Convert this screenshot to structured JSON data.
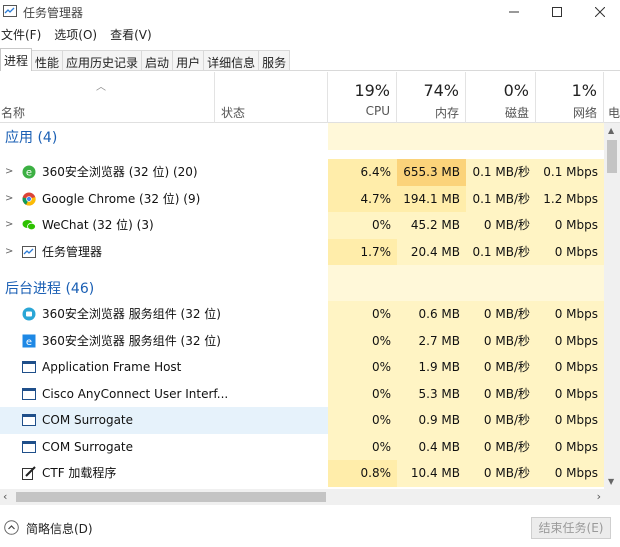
{
  "window": {
    "title": "任务管理器"
  },
  "menu": [
    "文件(F)",
    "选项(O)",
    "查看(V)"
  ],
  "tabs": [
    "进程",
    "性能",
    "应用历史记录",
    "启动",
    "用户",
    "详细信息",
    "服务"
  ],
  "header": {
    "name_label": "名称",
    "status_label": "状态",
    "cpu": {
      "pct": "19%",
      "label": "CPU"
    },
    "mem": {
      "pct": "74%",
      "label": "内存"
    },
    "disk": {
      "pct": "0%",
      "label": "磁盘"
    },
    "net": {
      "pct": "1%",
      "label": "网络"
    },
    "extra": "电"
  },
  "groups": {
    "apps": "应用 (4)",
    "background": "后台进程 (46)"
  },
  "apps": [
    {
      "name": "360安全浏览器 (32 位) (20)",
      "icon": "360-browser-icon",
      "cpu": "6.4%",
      "mem": "655.3 MB",
      "disk": "0.1 MB/秒",
      "net": "0.1 Mbps"
    },
    {
      "name": "Google Chrome (32 位) (9)",
      "icon": "chrome-icon",
      "cpu": "4.7%",
      "mem": "194.1 MB",
      "disk": "0.1 MB/秒",
      "net": "1.2 Mbps"
    },
    {
      "name": "WeChat (32 位) (3)",
      "icon": "wechat-icon",
      "cpu": "0%",
      "mem": "45.2 MB",
      "disk": "0 MB/秒",
      "net": "0 Mbps"
    },
    {
      "name": "任务管理器",
      "icon": "task-manager-icon",
      "cpu": "1.7%",
      "mem": "20.4 MB",
      "disk": "0.1 MB/秒",
      "net": "0 Mbps"
    }
  ],
  "background": [
    {
      "name": "360安全浏览器 服务组件 (32 位)",
      "icon": "360-service-icon",
      "cpu": "0%",
      "mem": "0.6 MB",
      "disk": "0 MB/秒",
      "net": "0 Mbps"
    },
    {
      "name": "360安全浏览器 服务组件 (32 位)",
      "icon": "360-service-alt-icon",
      "cpu": "0%",
      "mem": "2.7 MB",
      "disk": "0 MB/秒",
      "net": "0 Mbps"
    },
    {
      "name": "Application Frame Host",
      "icon": "window-icon",
      "cpu": "0%",
      "mem": "1.9 MB",
      "disk": "0 MB/秒",
      "net": "0 Mbps"
    },
    {
      "name": "Cisco AnyConnect User Interf...",
      "icon": "window-icon",
      "cpu": "0%",
      "mem": "5.3 MB",
      "disk": "0 MB/秒",
      "net": "0 Mbps"
    },
    {
      "name": "COM Surrogate",
      "icon": "window-icon",
      "cpu": "0%",
      "mem": "0.9 MB",
      "disk": "0 MB/秒",
      "net": "0 Mbps"
    },
    {
      "name": "COM Surrogate",
      "icon": "window-icon",
      "cpu": "0%",
      "mem": "0.4 MB",
      "disk": "0 MB/秒",
      "net": "0 Mbps"
    },
    {
      "name": "CTF 加载程序",
      "icon": "ctf-pen-icon",
      "cpu": "0.8%",
      "mem": "10.4 MB",
      "disk": "0 MB/秒",
      "net": "0 Mbps"
    }
  ],
  "footer": {
    "fewer_details": "简略信息(D)",
    "end_task": "结束任务(E)"
  },
  "colors": {
    "heat_low": "#fff4c4",
    "heat_mid": "#ffedaa",
    "heat_high": "#fbd37a",
    "group_title": "#1a5fb4",
    "selection": "#e6f2fb"
  }
}
